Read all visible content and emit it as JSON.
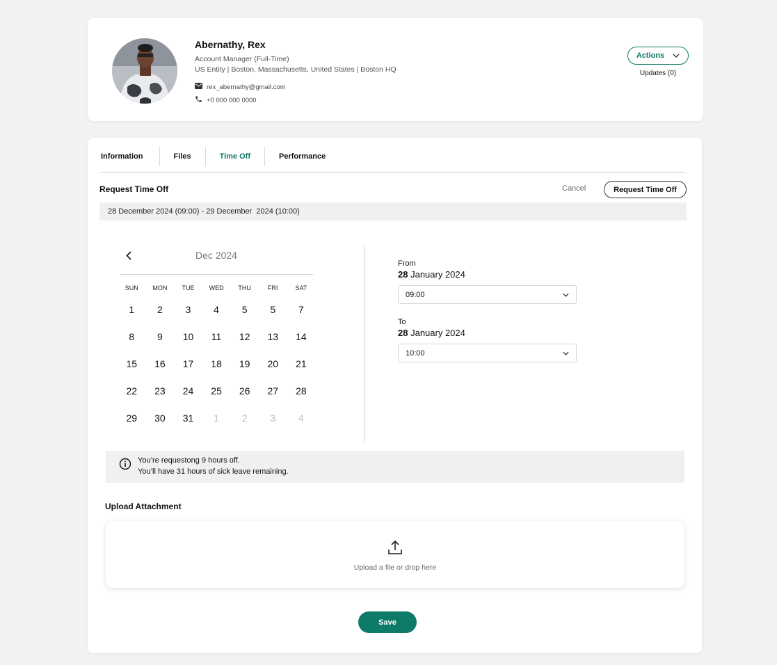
{
  "profile": {
    "name": "Abernathy, Rex",
    "role": "Account Manager (Full-Time)",
    "location": "US Entity | Boston, Massachusetts, United States | Boston HQ",
    "email": "rex_abernathy@gmail.com",
    "phone": "+0 000 000 0000",
    "actions_label": "Actions",
    "updates_label": "Updates (0)"
  },
  "tabs": [
    {
      "label": "Information",
      "active": false
    },
    {
      "label": "Files",
      "active": false
    },
    {
      "label": "Time Off",
      "active": true
    },
    {
      "label": "Performance",
      "active": false
    }
  ],
  "request": {
    "title": "Request Time Off",
    "cancel_label": "Cancel",
    "submit_label": "Request Time Off",
    "range_text": "28 December 2024 (09:00) - 29 December  2024 (10:00)"
  },
  "calendar": {
    "month_label": "Dec 2024",
    "weekdays": [
      "SUN",
      "MON",
      "TUE",
      "WED",
      "THU",
      "FRI",
      "SAT"
    ],
    "days": [
      {
        "d": "1"
      },
      {
        "d": "2"
      },
      {
        "d": "3"
      },
      {
        "d": "4"
      },
      {
        "d": "5"
      },
      {
        "d": "5"
      },
      {
        "d": "7"
      },
      {
        "d": "8"
      },
      {
        "d": "9"
      },
      {
        "d": "10"
      },
      {
        "d": "11"
      },
      {
        "d": "12"
      },
      {
        "d": "13"
      },
      {
        "d": "14"
      },
      {
        "d": "15"
      },
      {
        "d": "16"
      },
      {
        "d": "17"
      },
      {
        "d": "18"
      },
      {
        "d": "19"
      },
      {
        "d": "20"
      },
      {
        "d": "21"
      },
      {
        "d": "22"
      },
      {
        "d": "23"
      },
      {
        "d": "24"
      },
      {
        "d": "25"
      },
      {
        "d": "26"
      },
      {
        "d": "27"
      },
      {
        "d": "28"
      },
      {
        "d": "29"
      },
      {
        "d": "30"
      },
      {
        "d": "31"
      },
      {
        "d": "1",
        "muted": true
      },
      {
        "d": "2",
        "muted": true
      },
      {
        "d": "3",
        "muted": true
      },
      {
        "d": "4",
        "muted": true
      }
    ]
  },
  "from": {
    "label": "From",
    "day": "28",
    "month_year": "January 2024",
    "time": "09:00"
  },
  "to": {
    "label": "To",
    "day": "28",
    "month_year": "January 2024",
    "time": "10:00"
  },
  "info": {
    "line1": "You’re requestong 9 hours off.",
    "line2": "You’ll have 31 hours of sick leave remaining."
  },
  "upload": {
    "title": "Upload Attachment",
    "prompt": "Upload a file or drop here"
  },
  "save_label": "Save",
  "colors": {
    "accent": "#0e7a68",
    "background": "#f2f2f2",
    "panel": "#f0f0f0"
  }
}
